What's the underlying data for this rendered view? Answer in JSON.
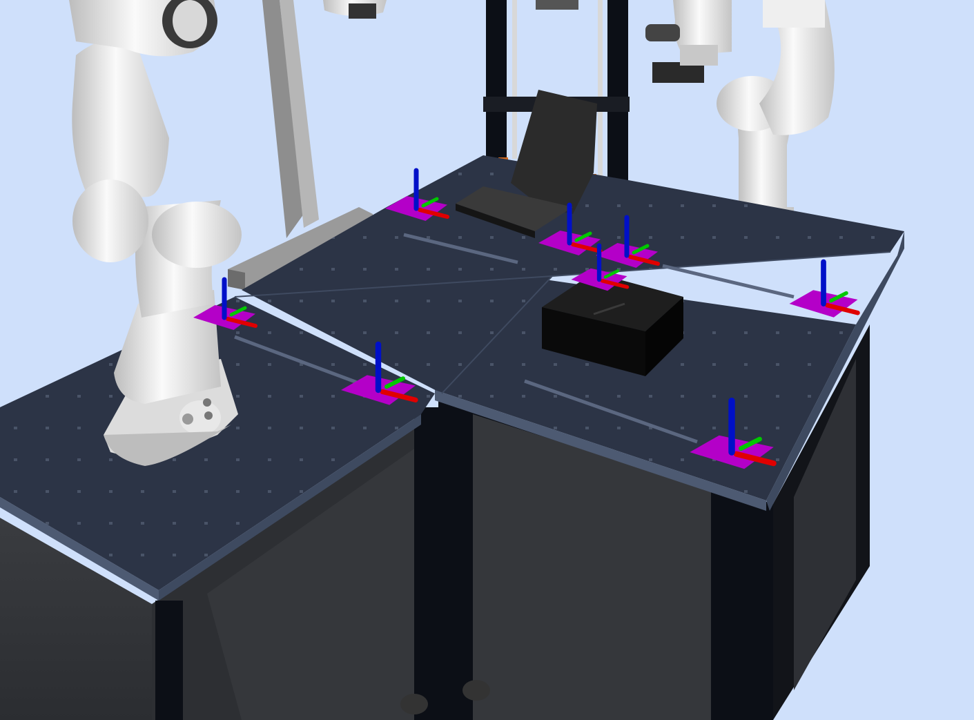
{
  "scene": {
    "background_color": "#cfe0fb",
    "table_top_color": "#2c3446",
    "cabinet_color": "#303236",
    "frame_color": "#0c0f16",
    "robot_color": "#f2f2f2",
    "marker_color": "#b400c8",
    "axis_colors": {
      "x": "#e00000",
      "y": "#00c800",
      "z": "#0010c8"
    },
    "objects": [
      {
        "name": "robot-arm-left",
        "kind": "robot-arm"
      },
      {
        "name": "robot-arm-right",
        "kind": "robot-arm"
      },
      {
        "name": "overhead-camera-mount",
        "kind": "camera"
      },
      {
        "name": "gray-bracket-stand",
        "kind": "stand"
      },
      {
        "name": "tool-rack-frame",
        "kind": "rack"
      },
      {
        "name": "black-tray-chute",
        "kind": "tray"
      },
      {
        "name": "black-box",
        "kind": "box"
      },
      {
        "name": "table-segments",
        "kind": "table"
      }
    ],
    "frame_markers_count": 8
  }
}
